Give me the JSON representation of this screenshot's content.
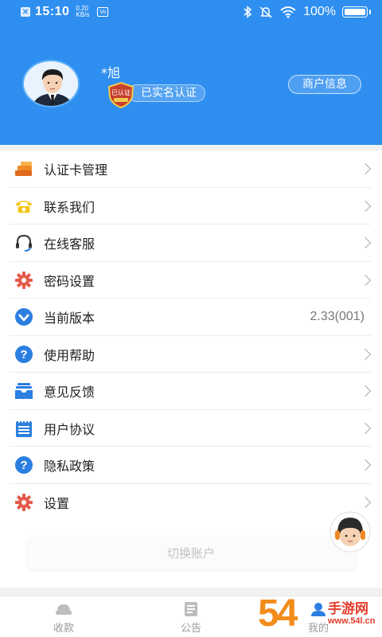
{
  "status_bar": {
    "time": "15:10",
    "net_speed_value": "0.20",
    "net_speed_unit": "KB/s",
    "battery": "100%"
  },
  "profile": {
    "username": "*旭",
    "badge_text": "已认证",
    "verified_label": "已实名认证",
    "merchant_button": "商户信息"
  },
  "menu": [
    {
      "label": "认证卡管理",
      "icon": "card-stack-icon",
      "value": ""
    },
    {
      "label": "联系我们",
      "icon": "telephone-icon",
      "value": ""
    },
    {
      "label": "在线客服",
      "icon": "headset-icon",
      "value": ""
    },
    {
      "label": "密码设置",
      "icon": "gear-icon",
      "value": ""
    },
    {
      "label": "当前版本",
      "icon": "version-check-icon",
      "value": "2.33(001)"
    },
    {
      "label": "使用帮助",
      "icon": "help-question-icon",
      "value": ""
    },
    {
      "label": "意见反馈",
      "icon": "feedback-inbox-icon",
      "value": ""
    },
    {
      "label": "用户协议",
      "icon": "agreement-notepad-icon",
      "value": ""
    },
    {
      "label": "隐私政策",
      "icon": "privacy-question-icon",
      "value": ""
    },
    {
      "label": "设置",
      "icon": "settings-gear-icon",
      "value": ""
    }
  ],
  "switch_account": "切换账户",
  "tabs": [
    {
      "label": "收款",
      "icon": "collect-money-icon"
    },
    {
      "label": "公告",
      "icon": "announcement-icon"
    },
    {
      "label": "我的",
      "icon": "profile-icon"
    }
  ],
  "watermark": {
    "number": "54",
    "text": "手游网",
    "url": "www.54l.cn"
  },
  "colors": {
    "header_blue": "#2f8ff0",
    "icon_blue": "#2b7fe0",
    "icon_orange": "#f08a24",
    "icon_red": "#e45b4b",
    "icon_yellow": "#f5c518"
  }
}
